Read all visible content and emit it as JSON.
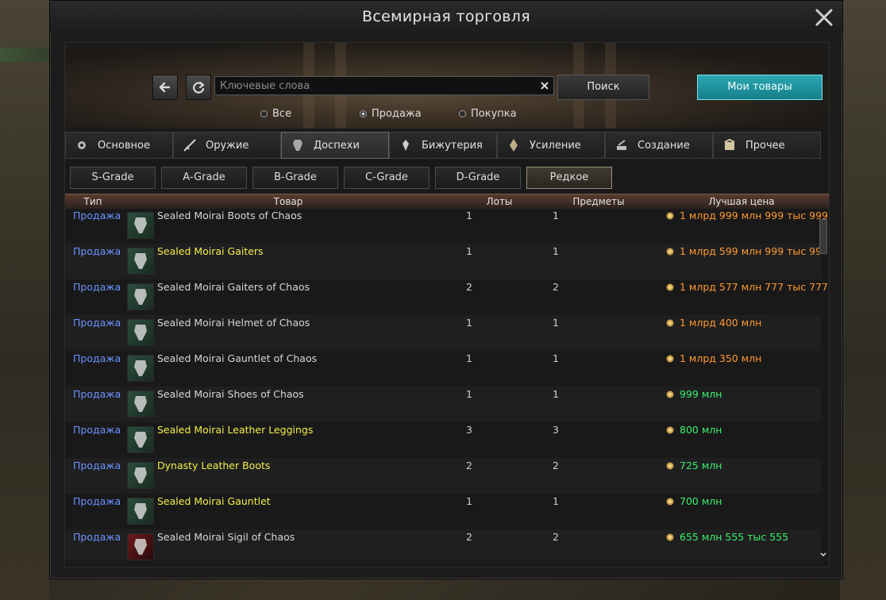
{
  "window": {
    "title": "Всемирная торговля"
  },
  "search": {
    "placeholder": "Ключевые слова",
    "search_label": "Поиск",
    "my_items_label": "Мои товары"
  },
  "filters": {
    "all": "Все",
    "sell": "Продажа",
    "buy": "Покупка",
    "selected": "Продажа"
  },
  "tabs": [
    {
      "label": "Основное",
      "icon": "settings-icon"
    },
    {
      "label": "Оружие",
      "icon": "weapon-icon"
    },
    {
      "label": "Доспехи",
      "icon": "armor-icon"
    },
    {
      "label": "Бижутерия",
      "icon": "jewelry-icon"
    },
    {
      "label": "Усиление",
      "icon": "enhancement-icon"
    },
    {
      "label": "Создание",
      "icon": "crafting-icon"
    },
    {
      "label": "Прочее",
      "icon": "misc-box-icon"
    }
  ],
  "active_tab": "Доспехи",
  "grades": [
    "S-Grade",
    "A-Grade",
    "B-Grade",
    "C-Grade",
    "D-Grade",
    "Редкое"
  ],
  "active_grade": "Редкое",
  "table": {
    "headers": [
      "Тип",
      "Товар",
      "Лоты",
      "Предметы",
      "Лучшая цена"
    ],
    "rows": [
      {
        "type": "Продажа",
        "name": "Sealed Moirai Boots of Chaos",
        "name_color": "default",
        "icon": "boots-icon",
        "lots": "1",
        "items": "1",
        "price": "1 млрд 999 млн 999 тыс 999",
        "price_color": "orange"
      },
      {
        "type": "Продажа",
        "name": "Sealed Moirai Gaiters",
        "name_color": "yellow",
        "icon": "gaiters-icon",
        "lots": "1",
        "items": "1",
        "price": "1 млрд 599 млн 999 тыс 99",
        "price_color": "orange"
      },
      {
        "type": "Продажа",
        "name": "Sealed Moirai Gaiters of Chaos",
        "name_color": "default",
        "icon": "gaiters-icon",
        "lots": "2",
        "items": "2",
        "price": "1 млрд 577 млн 777 тыс 777",
        "price_color": "orange"
      },
      {
        "type": "Продажа",
        "name": "Sealed Moirai Helmet of Chaos",
        "name_color": "default",
        "icon": "helmet-icon",
        "lots": "1",
        "items": "1",
        "price": "1 млрд 400 млн",
        "price_color": "orange"
      },
      {
        "type": "Продажа",
        "name": "Sealed Moirai Gauntlet of Chaos",
        "name_color": "default",
        "icon": "gauntlet-icon",
        "lots": "1",
        "items": "1",
        "price": "1 млрд 350 млн",
        "price_color": "orange"
      },
      {
        "type": "Продажа",
        "name": "Sealed Moirai Shoes of Chaos",
        "name_color": "default",
        "icon": "shoes-icon",
        "lots": "1",
        "items": "1",
        "price": "999 млн",
        "price_color": "green"
      },
      {
        "type": "Продажа",
        "name": "Sealed Moirai Leather Leggings",
        "name_color": "yellow",
        "icon": "leggings-icon",
        "lots": "3",
        "items": "3",
        "price": "800 млн",
        "price_color": "green"
      },
      {
        "type": "Продажа",
        "name": "Dynasty Leather Boots",
        "name_color": "yellow",
        "icon": "boots-icon",
        "lots": "2",
        "items": "2",
        "price": "725 млн",
        "price_color": "green"
      },
      {
        "type": "Продажа",
        "name": "Sealed Moirai Gauntlet",
        "name_color": "yellow",
        "icon": "gauntlet-icon",
        "lots": "1",
        "items": "1",
        "price": "700 млн",
        "price_color": "green"
      },
      {
        "type": "Продажа",
        "name": "Sealed Moirai Sigil of Chaos",
        "name_color": "default",
        "icon": "sigil-icon",
        "lots": "2",
        "items": "2",
        "price": "655 млн 555 тыс 555",
        "price_color": "green"
      }
    ]
  },
  "colors": {
    "link": "#6b93ff",
    "price_orange": "#ff9a2e",
    "price_green": "#39f06b",
    "name_yellow": "#f4ee4a",
    "accent_teal": "#2aa7b3"
  }
}
